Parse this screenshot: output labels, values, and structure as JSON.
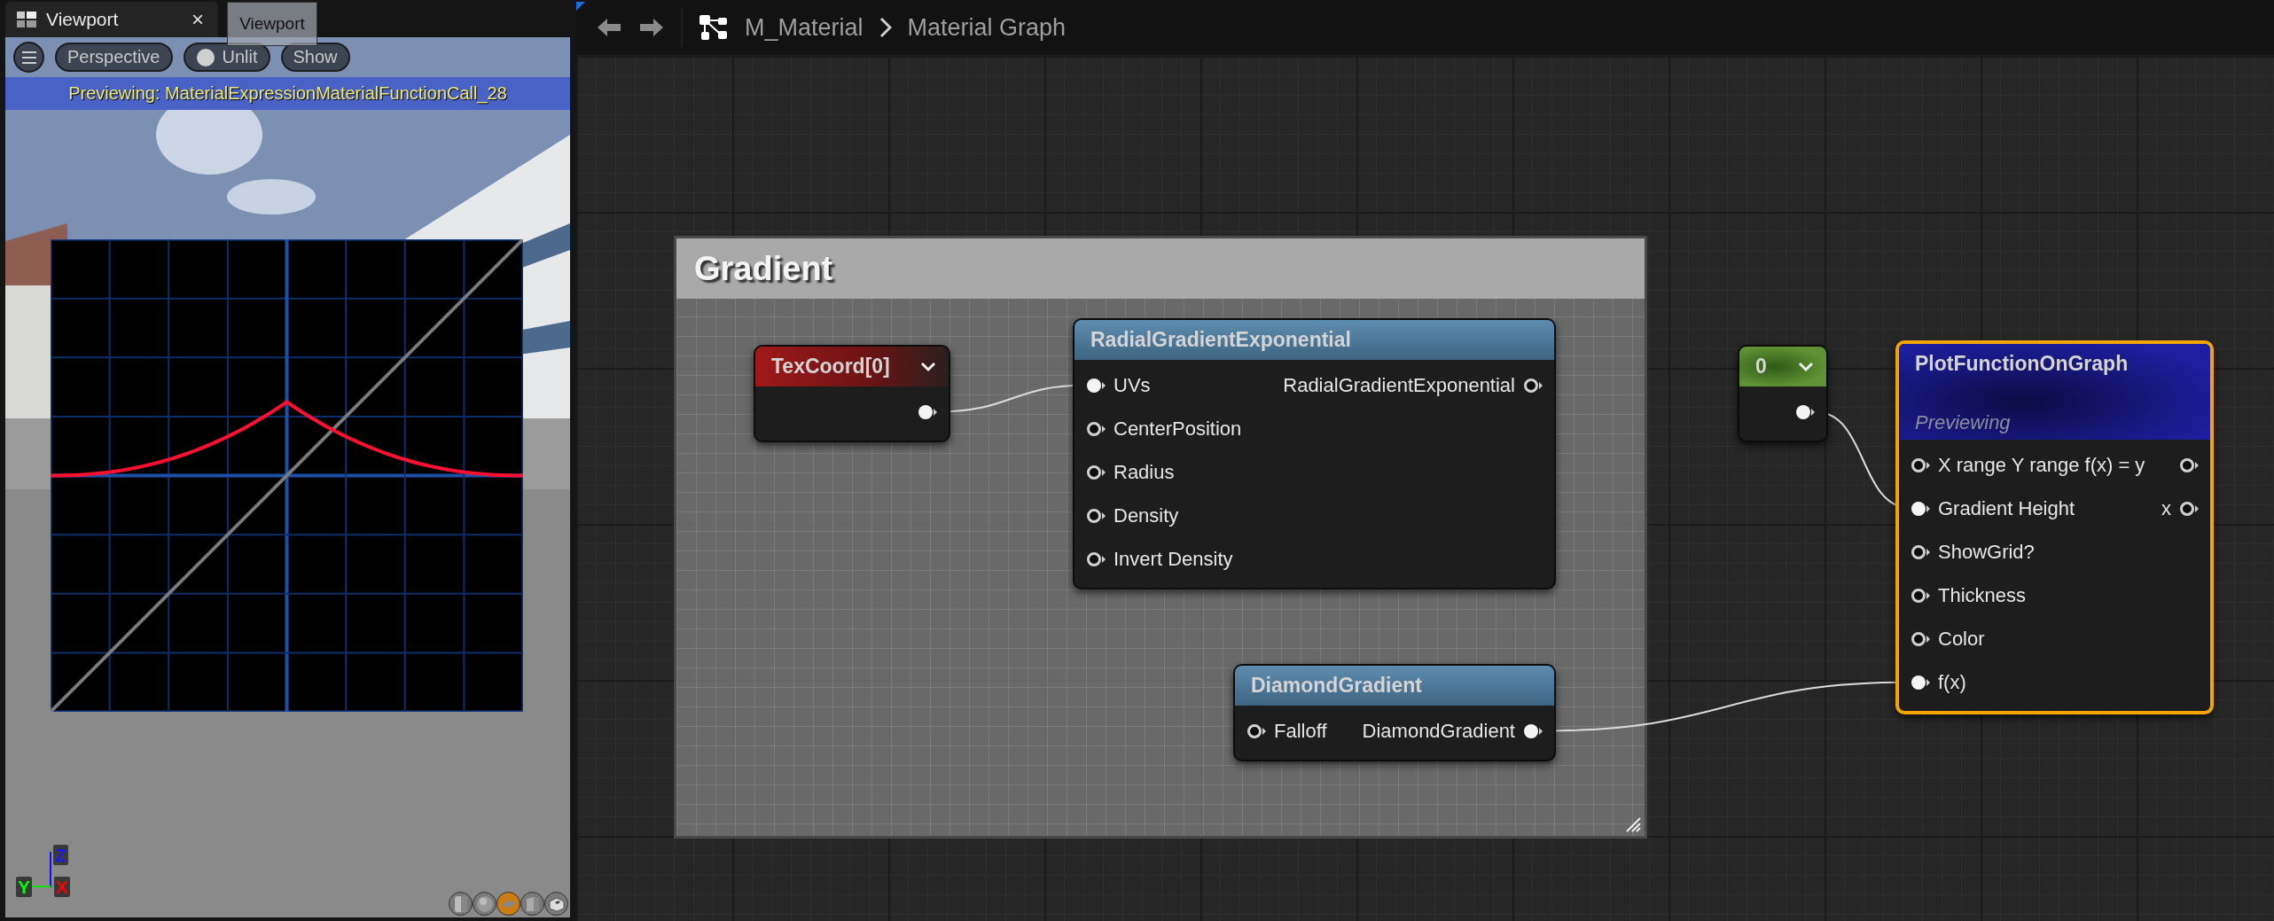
{
  "viewport": {
    "tab": {
      "title": "Viewport",
      "close_glyph": "×",
      "selected": true
    },
    "tooltip": "Viewport",
    "toolbar": [
      {
        "kind": "menu"
      },
      {
        "kind": "dropdown",
        "label": "Perspective"
      },
      {
        "kind": "toggle",
        "label": "Unlit"
      },
      {
        "kind": "dropdown",
        "label": "Show"
      }
    ],
    "banner": "Previewing: MaterialExpressionMaterialFunctionCall_28",
    "axes": {
      "z": "Z",
      "x": "X",
      "y": "Y"
    },
    "preview_shapes": [
      {
        "kind": "cylinder",
        "selected": false
      },
      {
        "kind": "sphere",
        "selected": false
      },
      {
        "kind": "plane",
        "selected": true
      },
      {
        "kind": "cube",
        "selected": false
      },
      {
        "kind": "mesh",
        "selected": false
      }
    ]
  },
  "graph": {
    "breadcrumb": [
      "M_Material",
      "Material Graph"
    ],
    "comment": {
      "title": "Gradient"
    },
    "nodes": [
      {
        "kind": "texcoord",
        "title": "TexCoord[0]",
        "dropdown": true,
        "selected": false,
        "rows": [
          {
            "output": {
              "connected": true
            }
          }
        ]
      },
      {
        "kind": "function",
        "title": "RadialGradientExponential",
        "selected": false,
        "rows": [
          {
            "input": {
              "label": "UVs",
              "connected": true
            },
            "output": {
              "label": "RadialGradientExponential",
              "connected": false
            }
          },
          {
            "input": {
              "label": "CenterPosition",
              "connected": false
            }
          },
          {
            "input": {
              "label": "Radius",
              "connected": false
            }
          },
          {
            "input": {
              "label": "Density",
              "connected": false
            }
          },
          {
            "input": {
              "label": "Invert Density",
              "connected": false
            }
          }
        ]
      },
      {
        "kind": "function",
        "title": "DiamondGradient",
        "selected": false,
        "rows": [
          {
            "input": {
              "label": "Falloff",
              "connected": false
            },
            "output": {
              "label": "DiamondGradient",
              "connected": true
            }
          }
        ]
      },
      {
        "kind": "constant",
        "title": "0",
        "dropdown": true,
        "selected": false,
        "rows": [
          {
            "output": {
              "connected": true
            }
          }
        ]
      },
      {
        "kind": "preview",
        "title": "PlotFunctionOnGraph",
        "subtitle": "Previewing",
        "selected": true,
        "rows": [
          {
            "input": {
              "label": "X range Y range f(x) = y",
              "connected": false
            },
            "output": {
              "connected": false
            }
          },
          {
            "input": {
              "label": "Gradient Height",
              "connected": true
            },
            "output": {
              "label": "x",
              "connected": false
            }
          },
          {
            "input": {
              "label": "ShowGrid?",
              "connected": false
            }
          },
          {
            "input": {
              "label": "Thickness",
              "connected": false
            }
          },
          {
            "input": {
              "label": "Color",
              "connected": false
            }
          },
          {
            "input": {
              "label": "f(x)",
              "connected": true
            }
          }
        ]
      }
    ]
  }
}
